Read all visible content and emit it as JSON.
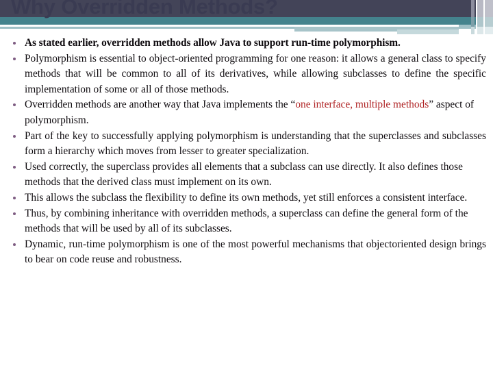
{
  "slide": {
    "title": "Why Overridden Methods?",
    "colors": {
      "header_navy": "#434458",
      "header_teal": "#44838D",
      "header_light_teal": "#9FC0C6",
      "title_text": "#3A3B52",
      "bullet_marker": "#7E5C82",
      "body_text": "#100C10",
      "highlight_red": "#B02526"
    },
    "bullets": [
      {
        "id": "bullet-1",
        "bold": true,
        "text": "As stated earlier, overridden methods allow Java to support run-time polymorphism."
      },
      {
        "id": "bullet-2",
        "bold": false,
        "text": "Polymorphism is essential to object-oriented programming for one reason: it allows a general class to specify methods that will be common to all of its derivatives, while allowing subclasses to define the specific implementation of some or all of those methods."
      },
      {
        "id": "bullet-3",
        "bold": false,
        "lead": "Overridden methods are another way that Java implements the “",
        "highlight": "one interface, multiple methods",
        "tail": "” aspect of polymorphism."
      },
      {
        "id": "bullet-4",
        "bold": false,
        "text": "Part of the key to successfully applying polymorphism is understanding that the superclasses and subclasses form a hierarchy which moves from lesser to greater specialization."
      },
      {
        "id": "bullet-5",
        "bold": false,
        "text": "Used correctly, the superclass provides all elements that a subclass can use directly. It also defines those methods that the derived class must implement on its own."
      },
      {
        "id": "bullet-6",
        "bold": false,
        "text": "This allows the subclass the flexibility to define its own methods, yet still enforces a consistent interface."
      },
      {
        "id": "bullet-7",
        "bold": false,
        "text": "Thus, by combining inheritance with overridden methods, a superclass can define the general form of the methods that will be used by all of its subclasses."
      },
      {
        "id": "bullet-8",
        "bold": false,
        "text": "Dynamic, run-time polymorphism is one of the most powerful mechanisms that objectoriented design brings to bear on code reuse and robustness."
      }
    ]
  }
}
